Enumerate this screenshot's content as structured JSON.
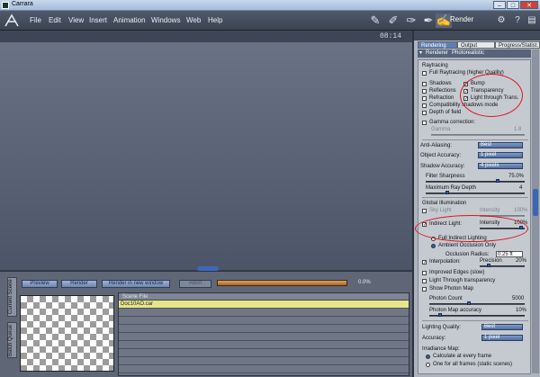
{
  "window": {
    "title": "Carrara",
    "min": "–",
    "max": "□",
    "close": "✕"
  },
  "menu": [
    "File",
    "Edit",
    "View",
    "Insert",
    "Animation",
    "Windows",
    "Web",
    "Help"
  ],
  "toolbar": {
    "room_label": "Render",
    "icons": [
      "assemble-room-icon",
      "model-room-icon",
      "storyboard-room-icon",
      "texture-room-icon",
      "render-room-icon"
    ]
  },
  "viewport": {
    "clock": "08:14"
  },
  "bottom": {
    "tabs": [
      "Current Scene",
      "Batch Queue"
    ],
    "buttons": {
      "preview": "Preview",
      "render": "Render",
      "render_new": "Render in new window",
      "abort": "Abort"
    },
    "progress": {
      "value": 0,
      "text": "0.0%"
    },
    "scene_header": "Scene File",
    "scene_rows": [
      "Doc10AO.car"
    ]
  },
  "panel": {
    "tabs": [
      "Rendering",
      "Output",
      "Progress/Statist."
    ],
    "renderer_label": "Renderer",
    "renderer_value": "Photorealistic",
    "raytracing": {
      "title": "Raytracing",
      "full": "Full Raytracing (higher Quality)",
      "shadows": "Shadows",
      "bump": "Bump",
      "reflections": "Reflections",
      "transparency": "Transparency",
      "refraction": "Refraction",
      "light_through": "Light through Trans.",
      "compat": "Compatibility shadows mode",
      "dof": "Depth of field",
      "gamma": "Gamma correction:",
      "gamma_label": "Gamma",
      "gamma_value": "1.8"
    },
    "quality": {
      "antialias_label": "Anti-Aliasing:",
      "antialias_value": "Best",
      "object_acc_label": "Object Accuracy:",
      "object_acc_value": "1 pixel",
      "shadow_acc_label": "Shadow Accuracy:",
      "shadow_acc_value": "4 pixels",
      "filter_label": "Filter Sharpness",
      "filter_value": "75.0%",
      "depth_label": "Maximum Ray Depth",
      "depth_value": "4"
    },
    "gi": {
      "title": "Global Illumination",
      "sky": "Sky Light",
      "sky_int": "Intensity",
      "sky_val": "100%",
      "indirect": "Indirect Light:",
      "ind_int": "Intensity",
      "ind_val": "100%",
      "full_indirect": "Full Indirect Lighting",
      "ao": "Ambient Occlusion Only",
      "radius_label": "Occlusion Radius:",
      "radius_value": "0.25 ft",
      "interp": "Interpolation:",
      "precision": "Precision",
      "precision_val": "20%",
      "edges": "Improved Edges (slow)",
      "light_trans": "Light Through transparency",
      "photon_map": "Show Photon Map",
      "photon_count": "Photon Count",
      "photon_count_val": "5000",
      "photon_acc": "Photon Map accuracy",
      "photon_acc_val": "10%",
      "lq_label": "Lighting Quality:",
      "lq_value": "Best",
      "acc_label": "Accuracy:",
      "acc_value": "1 pixel",
      "irr": "Irradiance Map:",
      "every_frame": "Calculate at every frame",
      "one_for_all": "One for all frames (static scenes)"
    }
  },
  "colors": {
    "annotation": "#e0141d",
    "accent": "#3d69b8",
    "selection": "#e7e58a"
  }
}
